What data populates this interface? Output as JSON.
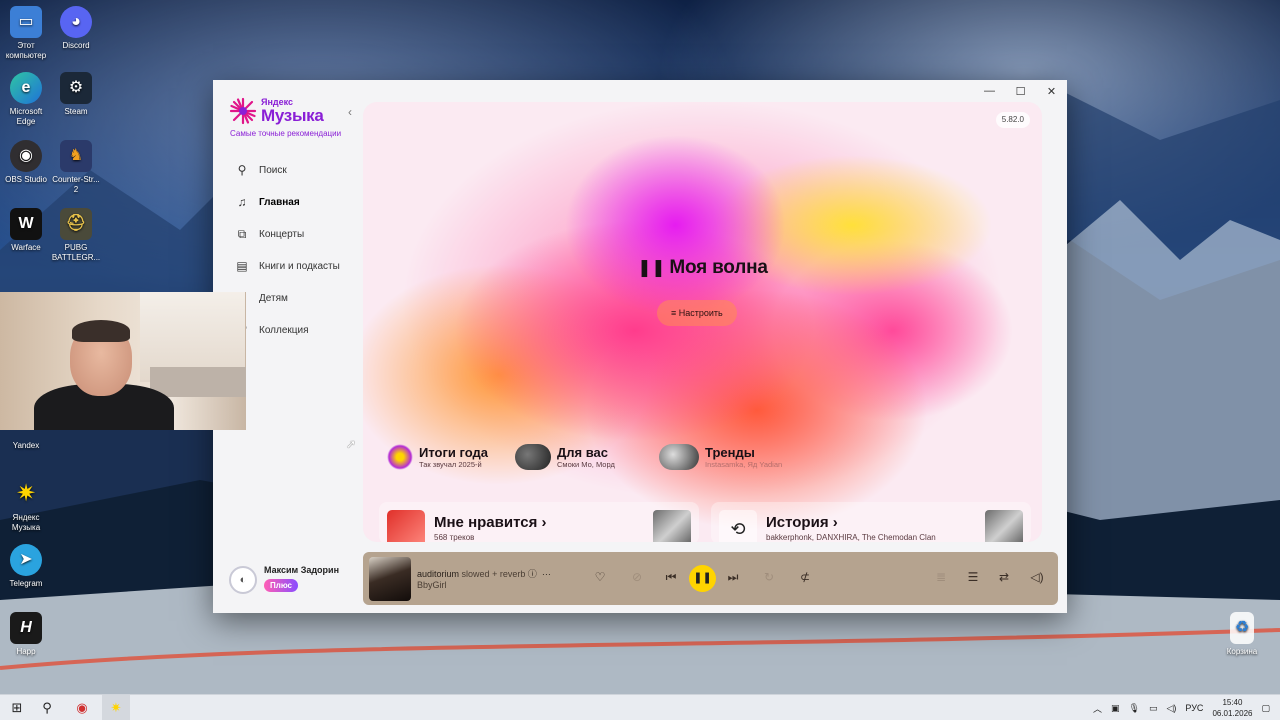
{
  "desktop": {
    "icons_left": [
      {
        "label": "Этот компьютер",
        "icon": "computer-icon"
      },
      {
        "label": "Discord",
        "icon": "discord-icon"
      },
      {
        "label": "Microsoft Edge",
        "icon": "edge-icon"
      },
      {
        "label": "Steam",
        "icon": "steam-icon"
      },
      {
        "label": "OBS Studio",
        "icon": "obs-icon"
      },
      {
        "label": "Counter-Str... 2",
        "icon": "counter-strike-icon"
      },
      {
        "label": "Warface",
        "icon": "warface-icon"
      },
      {
        "label": "PUBG BATTLEGR...",
        "icon": "pubg-icon"
      },
      {
        "label": "Yandex",
        "icon": "yandex-browser-icon"
      },
      {
        "label": "Яндекс Музыка",
        "icon": "yandex-music-icon"
      },
      {
        "label": "Telegram",
        "icon": "telegram-icon"
      },
      {
        "label": "Happ",
        "icon": "happ-icon"
      }
    ],
    "recycle_bin": {
      "label": "Корзина",
      "icon": "recycle-bin-icon"
    }
  },
  "app": {
    "brand_small": "Яндекс",
    "brand_big": "Музыка",
    "tagline": "Самые точные рекомендации",
    "version": "5.82.0",
    "nav": [
      {
        "label": "Поиск",
        "icon": "search-icon"
      },
      {
        "label": "Главная",
        "icon": "music-note-icon",
        "active": true
      },
      {
        "label": "Концерты",
        "icon": "ticket-icon"
      },
      {
        "label": "Книги и подкасты",
        "icon": "book-icon"
      },
      {
        "label": "Детям",
        "icon": "kids-icon"
      },
      {
        "label": "Коллекция",
        "icon": "collection-icon"
      }
    ],
    "user": {
      "name": "Максим Задорин",
      "badge": "Плюс"
    },
    "hero": {
      "title": "Моя волна",
      "tune_label": "Настроить"
    },
    "quick_links": [
      {
        "title": "Итоги года",
        "subtitle": "Так звучал 2025-й"
      },
      {
        "title": "Для вас",
        "subtitle": "Смоки Мо, Морд"
      },
      {
        "title": "Тренды",
        "subtitle": "Instasamka, Яд Yadian"
      }
    ],
    "tiles": [
      {
        "title": "Мне нравится",
        "subtitle": "568 треков"
      },
      {
        "title": "История",
        "subtitle": "bakkerphonk, DANXHIRA, The Chemodan Clan"
      }
    ],
    "player": {
      "track": "auditorium",
      "version": "slowed + reverb",
      "artist": "BbyGirl"
    }
  },
  "taskbar": {
    "language": "РУС",
    "time": "15:40",
    "date": "06.01.2026"
  },
  "colors": {
    "accent": "#8a1fd6",
    "play_button": "#ffd400",
    "player_bg": "#b5a38f"
  }
}
